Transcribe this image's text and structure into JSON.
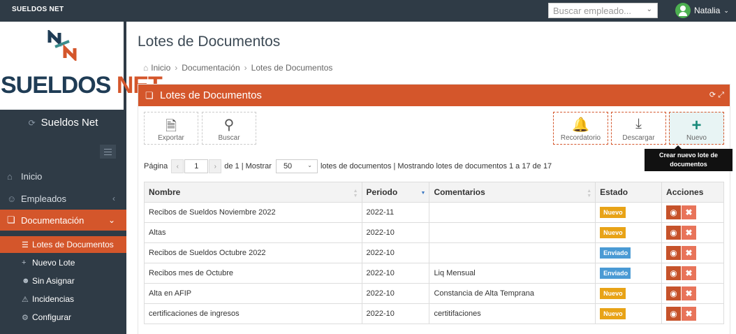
{
  "topbar": {
    "brand": "SUELDOS NET",
    "search_placeholder": "Buscar empleado...",
    "user_name": "Natalia"
  },
  "sidebar": {
    "logo_text_1": "SUELDOS ",
    "logo_text_2": "NET",
    "section_title": "Sueldos Net",
    "items": [
      {
        "label": "Inicio"
      },
      {
        "label": "Empleados"
      },
      {
        "label": "Documentación"
      }
    ],
    "subitems": [
      {
        "label": "Lotes de Documentos"
      },
      {
        "label": "Nuevo Lote"
      },
      {
        "label": "Sin Asignar"
      },
      {
        "label": "Incidencias"
      },
      {
        "label": "Configurar"
      }
    ]
  },
  "main": {
    "page_title": "Lotes de Documentos",
    "breadcrumb": [
      "Inicio",
      "Documentación",
      "Lotes de Documentos"
    ],
    "panel_title": "Lotes de Documentos",
    "toolbar": {
      "exportar": "Exportar",
      "buscar": "Buscar",
      "recordatorio": "Recordatorio",
      "descargar": "Descargar",
      "nuevo": "Nuevo"
    },
    "tooltip": "Crear nuevo lote de documentos",
    "pager": {
      "pagina_label": "Página",
      "page": "1",
      "of_text": "de 1 | Mostrar",
      "page_size": "50",
      "info": "lotes de documentos | Mostrando lotes de documentos 1 a 17 de 17"
    },
    "table": {
      "columns": [
        "Nombre",
        "Periodo",
        "Comentarios",
        "Estado",
        "Acciones"
      ],
      "rows": [
        {
          "nombre": "Recibos de Sueldos Noviembre 2022",
          "periodo": "2022-11",
          "comentarios": "",
          "estado": "Nuevo"
        },
        {
          "nombre": "Altas",
          "periodo": "2022-10",
          "comentarios": "",
          "estado": "Nuevo"
        },
        {
          "nombre": "Recibos de Sueldos Octubre 2022",
          "periodo": "2022-10",
          "comentarios": "",
          "estado": "Enviado"
        },
        {
          "nombre": "Recibos mes de Octubre",
          "periodo": "2022-10",
          "comentarios": "Liq Mensual",
          "estado": "Enviado"
        },
        {
          "nombre": "Alta en AFIP",
          "periodo": "2022-10",
          "comentarios": "Constancia de Alta Temprana",
          "estado": "Nuevo"
        },
        {
          "nombre": "certificaciones de ingresos",
          "periodo": "2022-10",
          "comentarios": "certitifaciones",
          "estado": "Nuevo"
        }
      ]
    }
  },
  "colors": {
    "accent": "#d4562b",
    "sidebar_bg": "#2f3b46",
    "badge_nuevo": "#e8a317",
    "badge_enviado": "#4a9ad4"
  }
}
